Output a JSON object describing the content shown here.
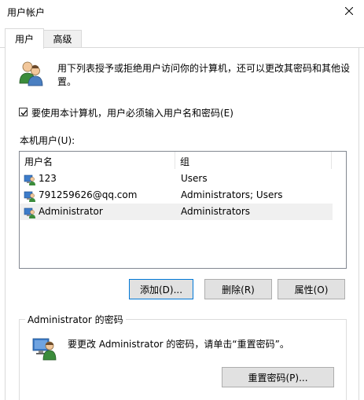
{
  "window": {
    "title": "用户帐户"
  },
  "tabs": [
    {
      "label": "用户"
    },
    {
      "label": "高级"
    }
  ],
  "intro": {
    "text": "用下列表授予或拒绝用户访问你的计算机，还可以更改其密码和其他设置。"
  },
  "require_login": {
    "label": "要使用本计算机，用户必须输入用户名和密码(E)",
    "checked": true
  },
  "local_users": {
    "label": "本机用户(U):",
    "columns": [
      "用户名",
      "组"
    ],
    "rows": [
      {
        "name": "123",
        "group": "Users",
        "selected": false
      },
      {
        "name": "791259626@qq.com",
        "group": "Administrators; Users",
        "selected": false
      },
      {
        "name": "Administrator",
        "group": "Administrators",
        "selected": true
      }
    ]
  },
  "buttons": {
    "add": "添加(D)...",
    "delete": "删除(R)",
    "properties": "属性(O)"
  },
  "password_group": {
    "title": "Administrator 的密码",
    "text": "要更改 Administrator 的密码，请单击“重置密码”。",
    "reset_button": "重置密码(P)..."
  },
  "colors": {
    "focus_border": "#0078d7",
    "selection": "#f0f0f0"
  }
}
